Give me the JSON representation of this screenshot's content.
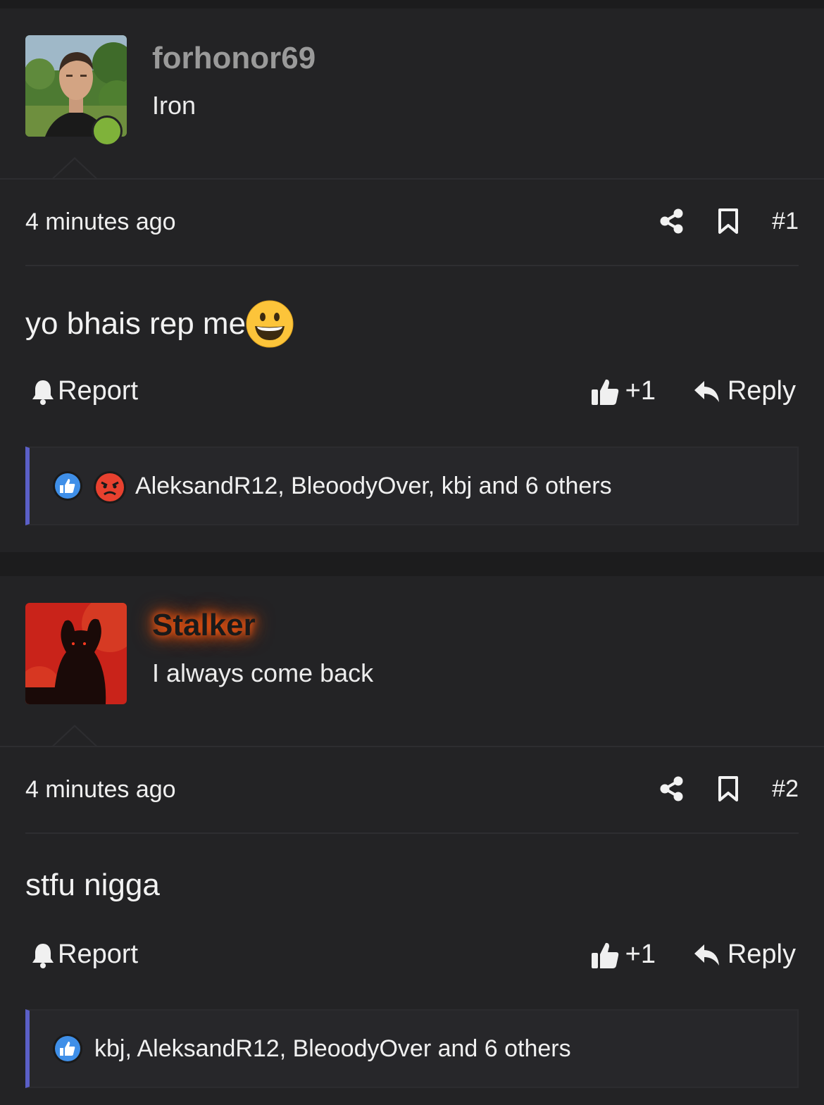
{
  "posts": [
    {
      "username": "forhonor69",
      "user_title": "Iron",
      "online": true,
      "timestamp": "4 minutes ago",
      "post_number": "#1",
      "message": "yo bhais rep me",
      "message_emoji": "grinning-face",
      "report_label": "Report",
      "like_label": "+1",
      "reply_label": "Reply",
      "reactions": [
        "like",
        "angry"
      ],
      "reactions_text": "AleksandR12, BleoodyOver, kbj and 6 others"
    },
    {
      "username": "Stalker",
      "user_title": "I always come back",
      "online": false,
      "timestamp": "4 minutes ago",
      "post_number": "#2",
      "message": "stfu nigga",
      "report_label": "Report",
      "like_label": "+1",
      "reply_label": "Reply",
      "reactions": [
        "like"
      ],
      "reactions_text": "kbj, AleksandR12, BleoodyOver and 6 others"
    }
  ],
  "colors": {
    "background": "#1c1c1d",
    "post_background": "#232325",
    "online_status": "#7fb23a",
    "reaction_accent": "#5b5fc7",
    "username_glow": "#ff5a12"
  }
}
